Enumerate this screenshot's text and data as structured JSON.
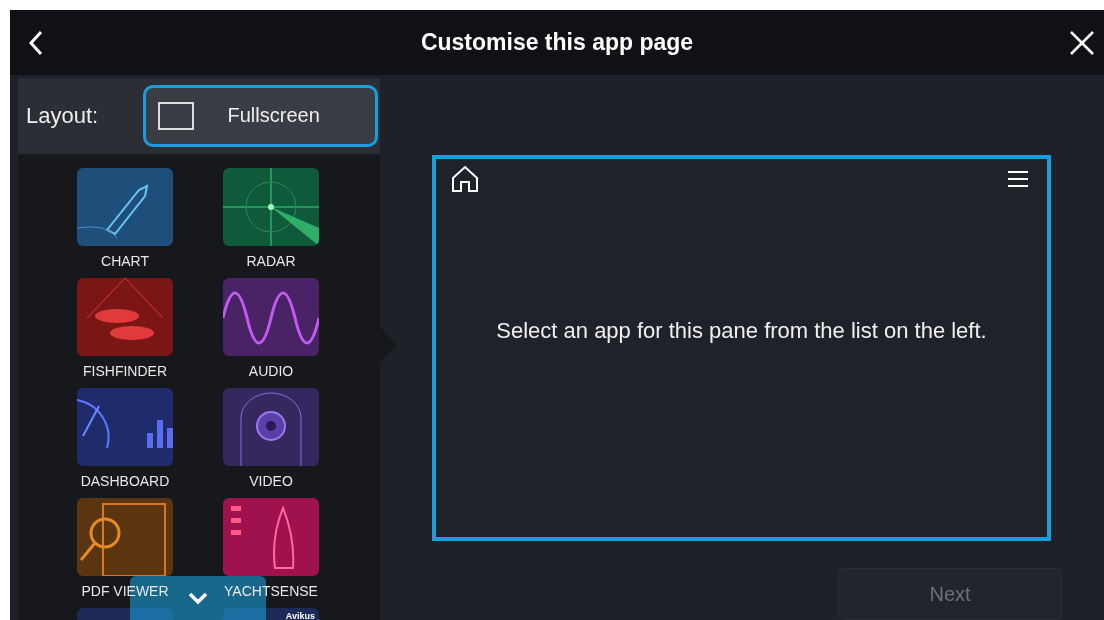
{
  "window": {
    "title": "Customise this app page"
  },
  "layout": {
    "label": "Layout:",
    "value": "Fullscreen"
  },
  "apps": [
    {
      "kind": "chart",
      "label": "CHART"
    },
    {
      "kind": "radar",
      "label": "RADAR"
    },
    {
      "kind": "fishfinder",
      "label": "FISHFINDER"
    },
    {
      "kind": "audio",
      "label": "AUDIO"
    },
    {
      "kind": "dashboard",
      "label": "DASHBOARD"
    },
    {
      "kind": "video",
      "label": "VIDEO"
    },
    {
      "kind": "pdf",
      "label": "PDF VIEWER"
    },
    {
      "kind": "yachtsense",
      "label": "YACHTSENSE"
    }
  ],
  "partial_apps": [
    {
      "kind": "plain"
    },
    {
      "kind": "badge",
      "badge": "Avikus"
    }
  ],
  "preview": {
    "message": "Select an app for this pane from the list on the left."
  },
  "next_button": {
    "label": "Next",
    "disabled": true
  }
}
